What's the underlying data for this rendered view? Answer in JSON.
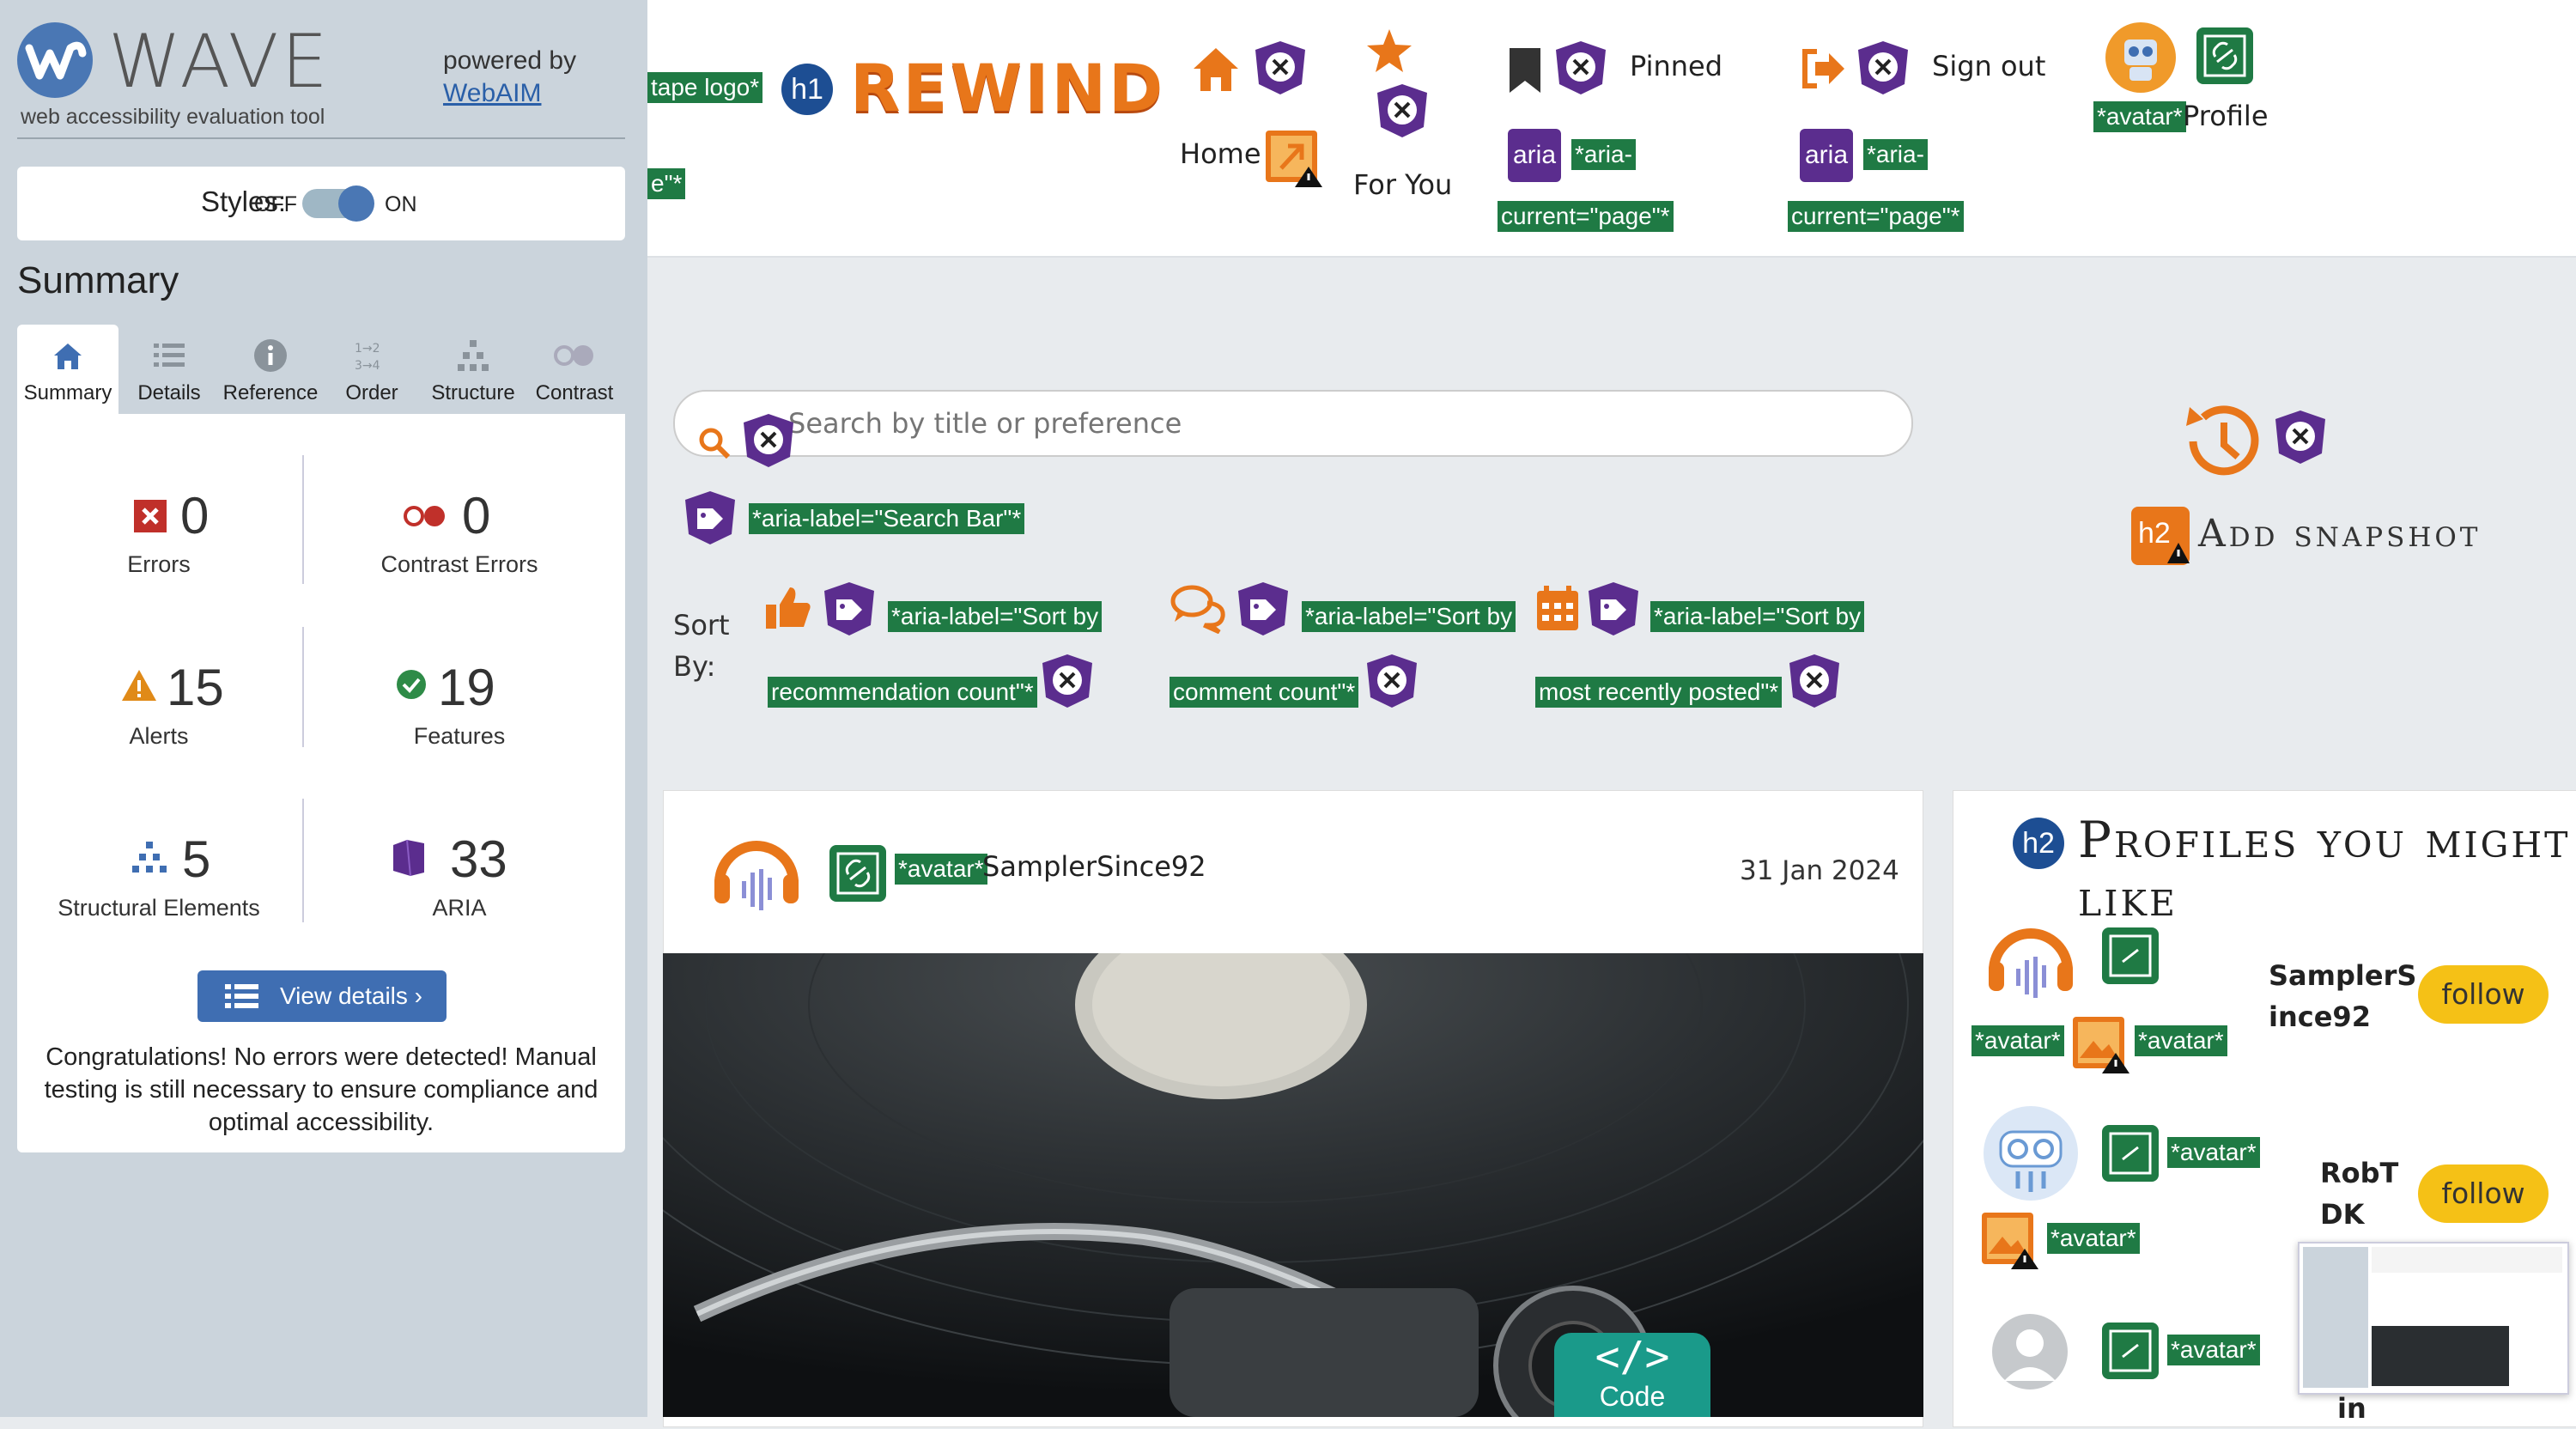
{
  "wave": {
    "title": "WAVE",
    "subtitle": "web accessibility evaluation tool",
    "powered_by": "powered by",
    "webaim_link": "WebAIM",
    "styles_label": "Styles:",
    "toggle_off": "OFF",
    "toggle_on": "ON",
    "summary_heading": "Summary",
    "tabs": [
      {
        "label": "Summary",
        "icon": "home-icon"
      },
      {
        "label": "Details",
        "icon": "list-icon"
      },
      {
        "label": "Reference",
        "icon": "info-icon"
      },
      {
        "label": "Order",
        "icon": "order-icon"
      },
      {
        "label": "Structure",
        "icon": "structure-icon"
      },
      {
        "label": "Contrast",
        "icon": "contrast-icon"
      }
    ],
    "stats": {
      "errors": {
        "value": "0",
        "label": "Errors"
      },
      "contrast_errors": {
        "value": "0",
        "label": "Contrast Errors"
      },
      "alerts": {
        "value": "15",
        "label": "Alerts"
      },
      "features": {
        "value": "19",
        "label": "Features"
      },
      "structural": {
        "value": "5",
        "label": "Structural Elements"
      },
      "aria": {
        "value": "33",
        "label": "ARIA"
      }
    },
    "view_details": "View details ›",
    "congrats": "Congratulations! No errors were detected! Manual testing is still necessary to ensure compliance and optimal accessibility."
  },
  "header": {
    "tape_logo_tag": "tape logo*",
    "tape_logo_tag2": "e\"*",
    "h1_badge": "h1",
    "brand": "REWIND",
    "nav": {
      "home": "Home",
      "for_you": "For You",
      "pinned": "Pinned",
      "sign_out": "Sign out",
      "profile": "Profile"
    },
    "aria_badge": "aria",
    "aria_current_1": "*aria-",
    "aria_current_2": "current=\"page\"*",
    "avatar_tag": "*avatar*"
  },
  "search": {
    "placeholder": "Search by title or preference",
    "aria_tag": "*aria-label=\"Search Bar\"*"
  },
  "snapshot": {
    "h2_badge": "h2",
    "label": "Add snapshot"
  },
  "sort": {
    "label_1": "Sort",
    "label_2": "By:",
    "rec_1": "*aria-label=\"Sort by",
    "rec_2": "recommendation count\"*",
    "com_1": "*aria-label=\"Sort by",
    "com_2": "comment count\"*",
    "date_1": "*aria-label=\"Sort by",
    "date_2": "most recently posted\"*"
  },
  "post": {
    "avatar_tag": "*avatar*",
    "username": "SamplerSince92",
    "date": "31 Jan 2024",
    "code_label": "Code"
  },
  "profiles": {
    "h2_badge": "h2",
    "heading": "Profiles you might like",
    "avatar_tag": "*avatar*",
    "follow_label": "follow",
    "items": [
      {
        "name_1": "SamplerS",
        "name_2": "ince92"
      },
      {
        "name_1": "RobT",
        "name_2": "DK"
      },
      {
        "name_1": "",
        "name_2": "in"
      }
    ]
  },
  "colors": {
    "wave_blue": "#4a77b4",
    "tag_green": "#1f7a44",
    "aria_purple": "#5b2d8e",
    "brand_orange": "#e8761a",
    "follow_yellow": "#f5c116"
  }
}
